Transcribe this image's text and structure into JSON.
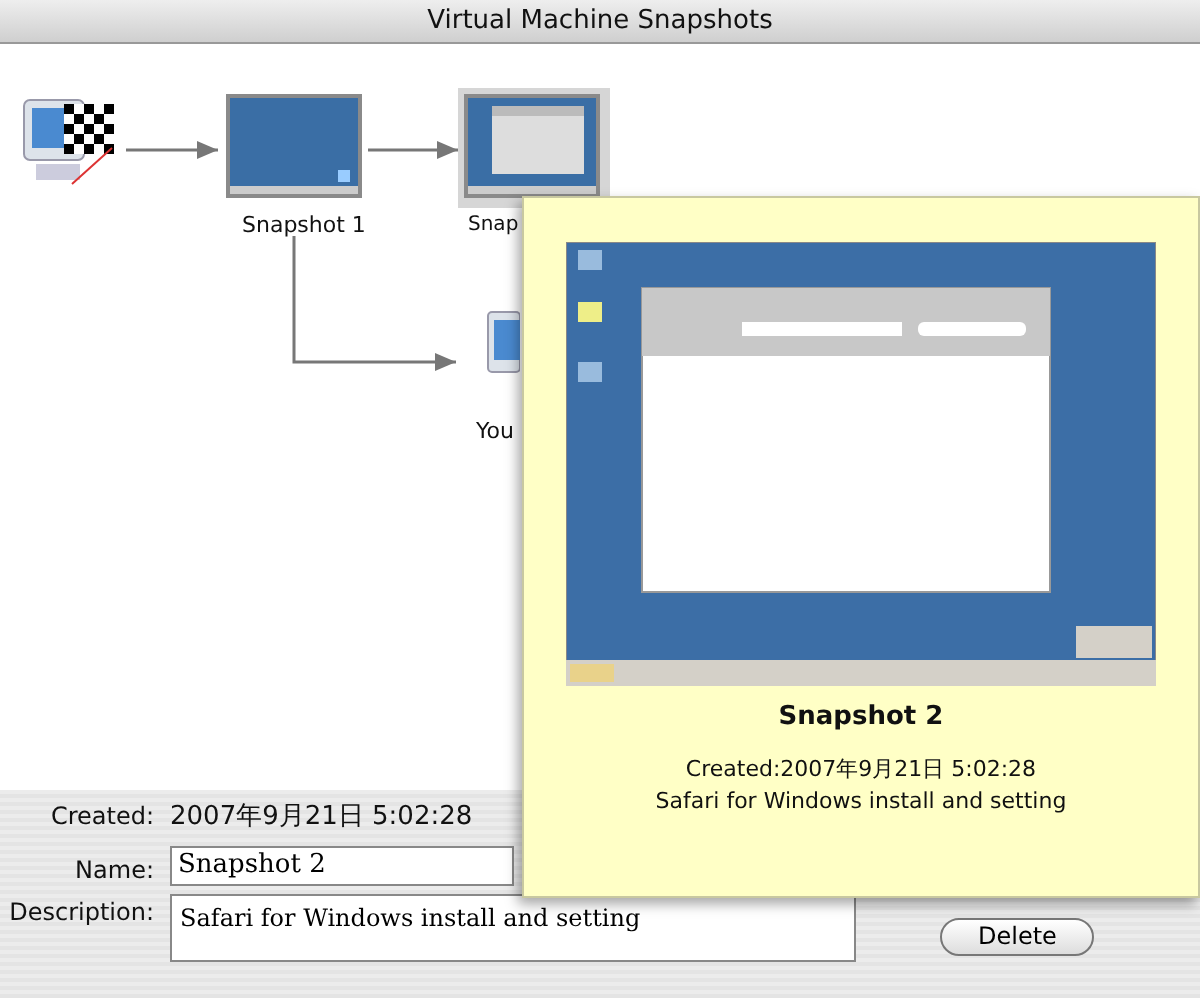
{
  "window": {
    "title": "Virtual Machine Snapshots"
  },
  "nodes": [
    {
      "kind": "start"
    },
    {
      "kind": "snapshot",
      "label": "Snapshot 1",
      "selected": false
    },
    {
      "kind": "snapshot",
      "label": "Snap",
      "selected": true
    },
    {
      "kind": "current",
      "label": "You"
    }
  ],
  "tooltip": {
    "title": "Snapshot 2",
    "created": "Created:2007年9月21日 5:02:28",
    "description": "Safari for Windows install and setting"
  },
  "details": {
    "created_label": "Created:",
    "created_value": "2007年9月21日 5:02:28",
    "name_label": "Name:",
    "name_value": "Snapshot 2",
    "description_label": "Description:",
    "description_value": "Safari for Windows install and setting",
    "delete_button": "Delete"
  }
}
